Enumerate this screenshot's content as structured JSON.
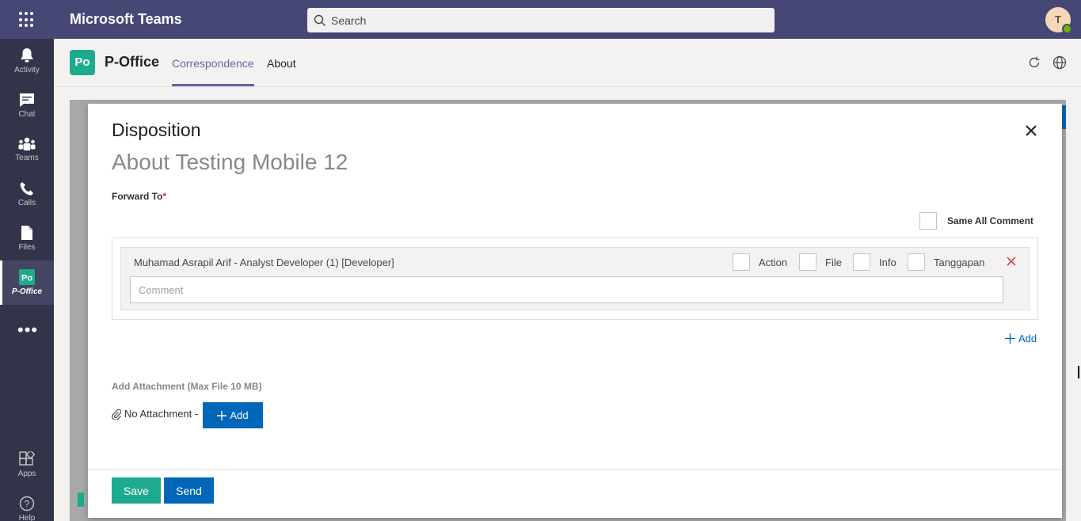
{
  "app": {
    "title": "Microsoft Teams"
  },
  "search": {
    "placeholder": "Search"
  },
  "user": {
    "initial": "T"
  },
  "rail": {
    "items": [
      {
        "label": "Activity",
        "icon": "bell-icon"
      },
      {
        "label": "Chat",
        "icon": "chat-icon"
      },
      {
        "label": "Teams",
        "icon": "teams-icon"
      },
      {
        "label": "Calls",
        "icon": "phone-icon"
      },
      {
        "label": "Files",
        "icon": "file-icon"
      },
      {
        "label": "P-Office",
        "icon": "p-office-icon",
        "active": true
      }
    ],
    "more": "•••",
    "bottom": [
      {
        "label": "Apps",
        "icon": "apps-icon"
      },
      {
        "label": "Help",
        "icon": "help-icon"
      }
    ]
  },
  "app_header": {
    "logo_text": "Po",
    "name": "P-Office",
    "tabs": [
      {
        "label": "Correspondence",
        "active": true
      },
      {
        "label": "About",
        "active": false
      }
    ]
  },
  "modal": {
    "title": "Disposition",
    "subtitle": "About Testing Mobile 12",
    "forward_label": "Forward To",
    "required_mark": "*",
    "same_all_comment": "Same All Comment",
    "recipient": {
      "name": "Muhamad Asrapil Arif - Analyst Developer (1) [Developer]",
      "options": [
        "Action",
        "File",
        "Info",
        "Tanggapan"
      ],
      "comment_placeholder": "Comment"
    },
    "add_label": "Add",
    "attachment_label": "Add Attachment (Max File 10 MB)",
    "no_attachment": "No Attachment -",
    "attach_add_label": "Add",
    "save_label": "Save",
    "send_label": "Send"
  },
  "colors": {
    "teams_purple": "#464775",
    "rail": "#33344a",
    "accent": "#6264a7",
    "brand_green": "#1eab8d",
    "primary_blue": "#0067b8",
    "danger": "#d13438"
  }
}
